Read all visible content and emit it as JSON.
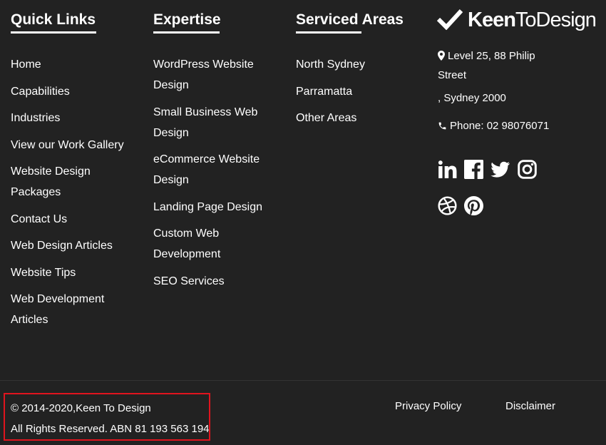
{
  "quick_links": {
    "heading": "Quick Links",
    "items": [
      "Home",
      "Capabilities",
      "Industries",
      "View our Work Gallery",
      "Website Design Packages",
      "Contact Us",
      "Web Design Articles",
      "Website Tips",
      "Web Development Articles"
    ]
  },
  "expertise": {
    "heading": "Expertise",
    "items": [
      "WordPress Website Design",
      "Small Business Web Design",
      "eCommerce Website Design",
      "Landing Page Design",
      "Custom Web Development",
      "SEO Services"
    ]
  },
  "serviced_areas": {
    "heading": "Serviced Areas",
    "items": [
      "North Sydney",
      "Parramatta",
      "Other Areas"
    ]
  },
  "brand": {
    "logo_part1": "Keen",
    "logo_part2": "ToDesign",
    "logo_icon": "checkmark-icon"
  },
  "contact": {
    "address_line1": "Level 25, 88 Philip",
    "address_line2": "Street",
    "address_line3": ", Sydney 2000",
    "phone": "Phone: 02 98076071",
    "address_icon": "map-marker-icon",
    "phone_icon": "phone-icon"
  },
  "social_icons": [
    "linkedin-icon",
    "facebook-icon",
    "twitter-icon",
    "instagram-icon",
    "dribbble-icon",
    "pinterest-icon"
  ],
  "footer": {
    "copyright": "© 2014-2020,Keen To Design",
    "rights": "All Rights Reserved. ABN 81 193 563 194",
    "privacy": "Privacy Policy",
    "disclaimer": "Disclaimer",
    "highlight_color": "#e0141e"
  },
  "colors": {
    "background": "#222222",
    "text": "#ffffff"
  }
}
